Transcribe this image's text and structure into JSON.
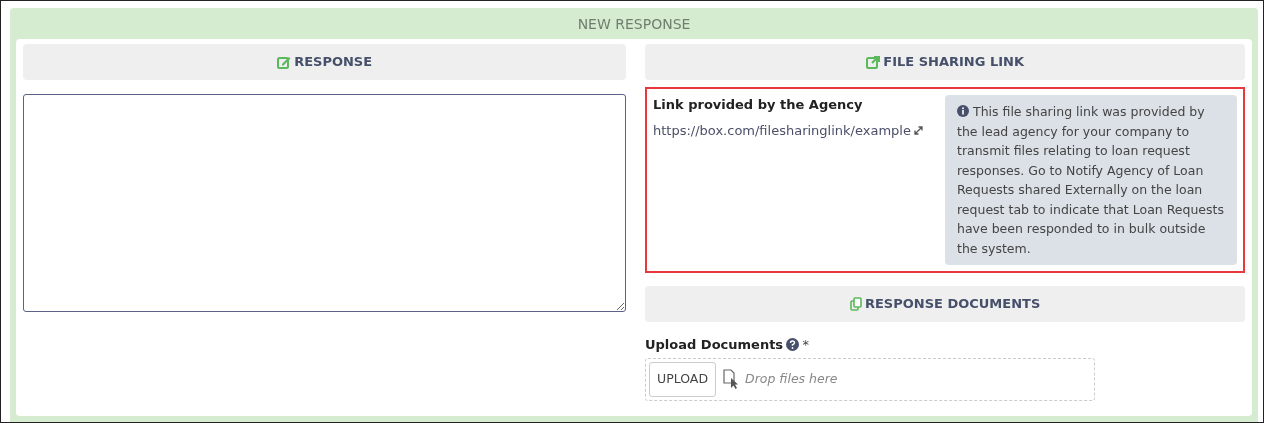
{
  "panel": {
    "title": "NEW RESPONSE"
  },
  "response": {
    "heading": "RESPONSE"
  },
  "file_sharing": {
    "heading": "FILE SHARING LINK",
    "highlighted": true,
    "label": "Link provided by the Agency",
    "link": "https://box.com/filesharinglink/example",
    "info": "This file sharing link was provided by the lead agency for your company to transmit files relating to loan request responses. Go to Notify Agency of Loan Requests shared Externally on the loan request tab to indicate that Loan Requests have been responded to in bulk outside the system."
  },
  "documents": {
    "heading": "RESPONSE DOCUMENTS",
    "label": "Upload Documents",
    "required_mark": "*",
    "upload_button": "UPLOAD",
    "drop_placeholder": "Drop files here"
  }
}
